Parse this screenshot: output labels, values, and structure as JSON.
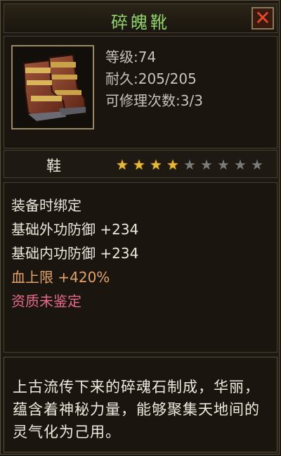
{
  "title": "碎魄靴",
  "close_label": "✕",
  "item": {
    "icon": "boots-icon",
    "stats": [
      "等级:74",
      "耐久:205/205",
      "可修理次数:3/3"
    ],
    "type": "鞋",
    "stars_total": 9,
    "stars_filled": 4
  },
  "attributes": [
    {
      "text": "装备时绑定",
      "color": "#eae6dc"
    },
    {
      "text": "基础外功防御  +234",
      "color": "#eae6dc"
    },
    {
      "text": "基础内功防御  +234",
      "color": "#eae6dc"
    },
    {
      "text": "血上限  +420%",
      "color": "#e3a36a"
    },
    {
      "text": "资质未鉴定",
      "color": "#e56a8a"
    }
  ],
  "description": "上古流传下来的碎魂石制成，华丽，蕴含着神秘力量，能够聚集天地间的灵气化为己用。"
}
